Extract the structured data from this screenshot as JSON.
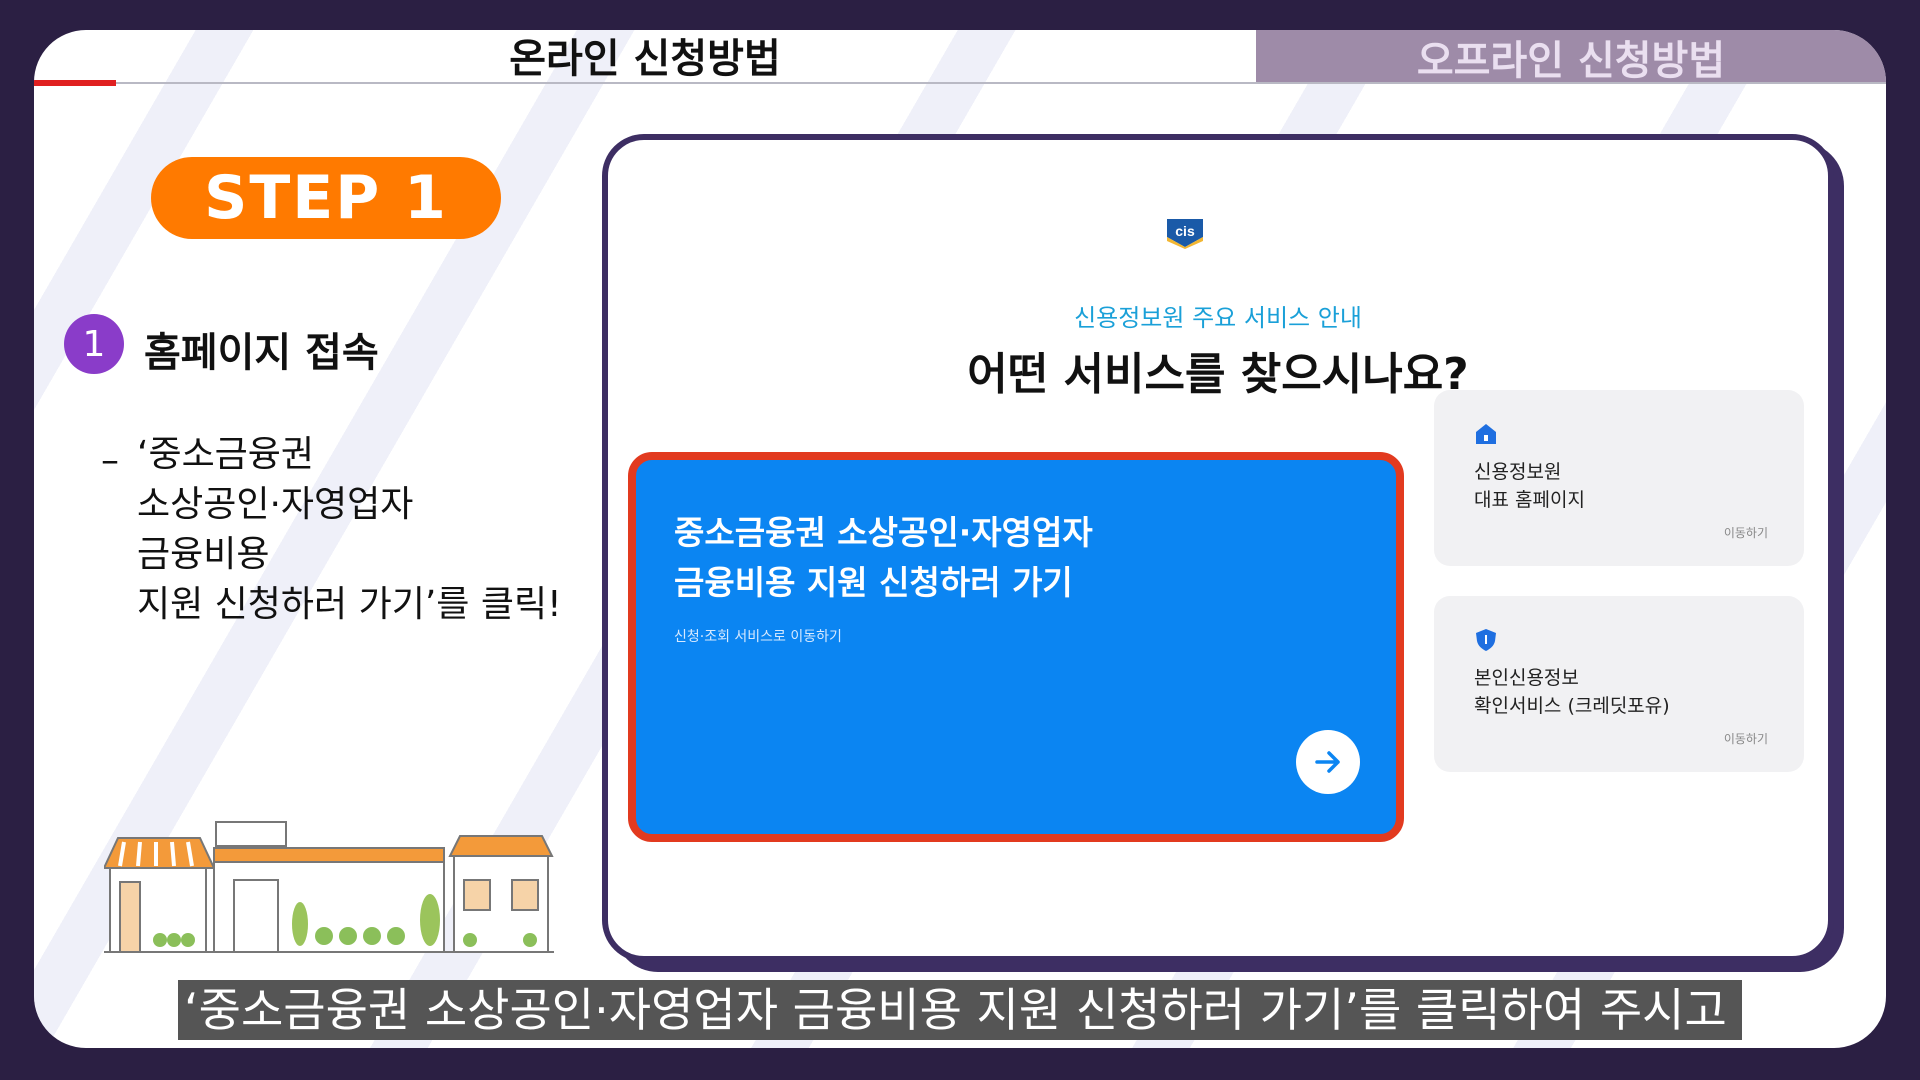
{
  "header": {
    "tab_online": "온라인 신청방법",
    "tab_offline": "오프라인 신청방법"
  },
  "step": {
    "badge": "STEP 1",
    "number": "1",
    "title": "홈페이지 접속",
    "dash": "–",
    "desc_lines": [
      "‘중소금융권",
      "소상공인·자영업자",
      "금융비용",
      "지원 신청하러 가기’를 클릭!"
    ]
  },
  "site": {
    "subtitle": "신용정보원 주요 서비스 안내",
    "title": "어떤 서비스를 찾으시나요?",
    "main_card": {
      "title_lines": [
        "중소금융권 소상공인·자영업자",
        "금융비용 지원 신청하러 가기"
      ],
      "sub": "신청·조회 서비스로 이동하기"
    },
    "side_cards": [
      {
        "lines": [
          "신용정보원",
          "대표 홈페이지"
        ],
        "link": "이동하기"
      },
      {
        "lines": [
          "본인신용정보",
          "확인서비스 (크레딧포유)"
        ],
        "link": "이동하기"
      }
    ]
  },
  "caption": "‘중소금융권 소상공인·자영업자 금융비용 지원 신청하러 가기’를 클릭하여 주시고",
  "colors": {
    "accent_orange": "#ff7a00",
    "accent_purple": "#8a3cc9",
    "card_blue": "#0b85f2",
    "highlight_red": "#e23a1f"
  }
}
